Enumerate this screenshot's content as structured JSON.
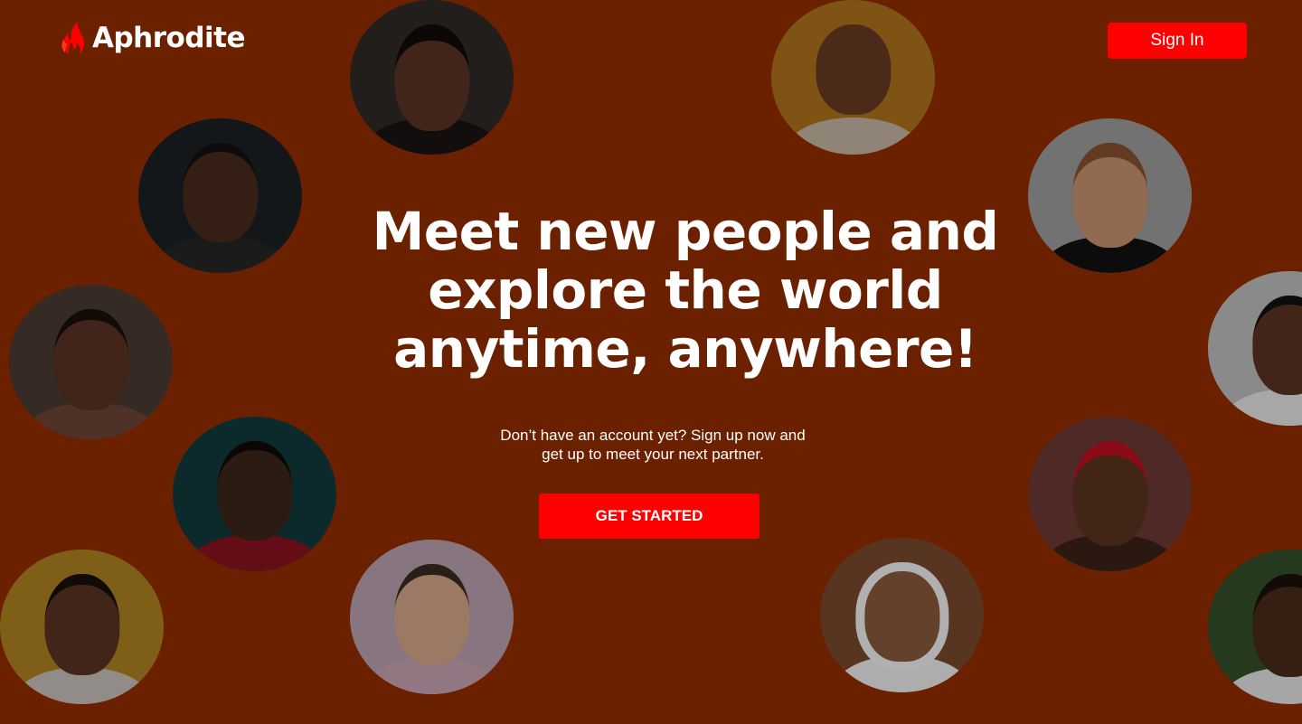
{
  "brand": {
    "name": "Aphrodite",
    "icon": "flame-icon",
    "accent": "#ff0000"
  },
  "header": {
    "signin_label": "Sign In"
  },
  "hero": {
    "line1": "Meet new people and",
    "line2": "explore the world",
    "line3": "anytime, anywhere!"
  },
  "subtitle": {
    "line1": "Don’t have an account yet? Sign up now and",
    "line2": "get up to meet your next partner."
  },
  "cta": {
    "label": "GET STARTED"
  },
  "colors": {
    "background": "#6b2000",
    "button": "#ff0000",
    "text": "#ffffff"
  }
}
